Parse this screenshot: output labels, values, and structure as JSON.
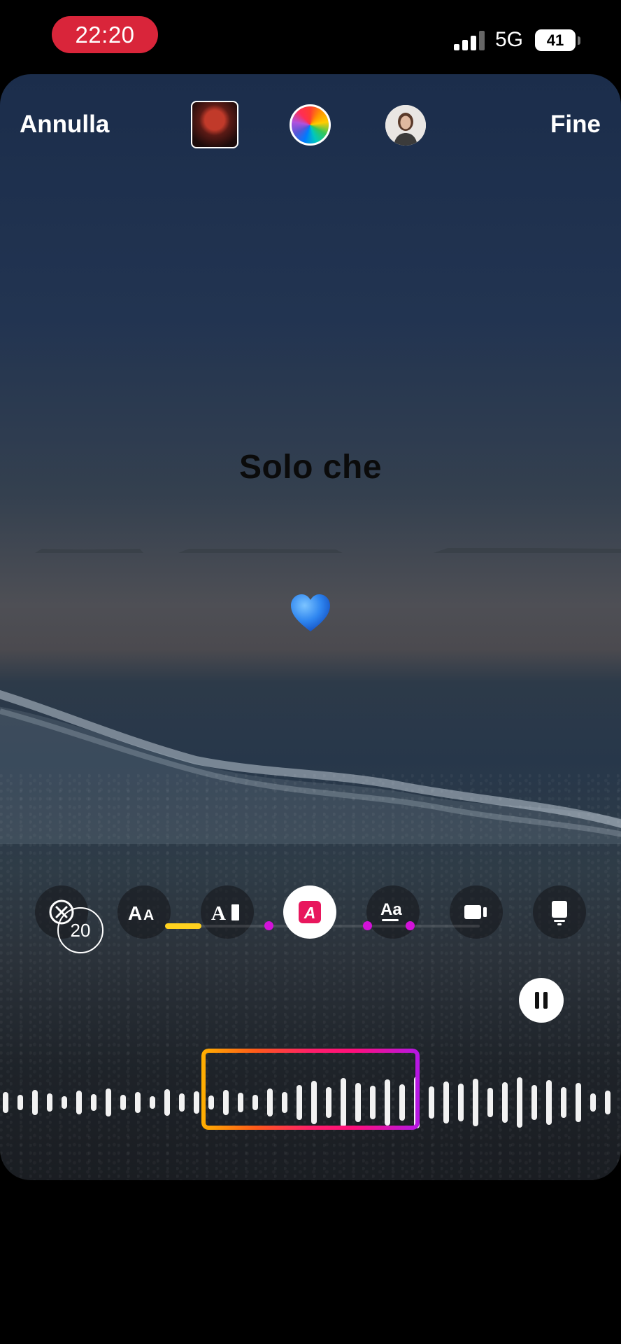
{
  "status_bar": {
    "time": "22:20",
    "network": "5G",
    "battery": "41",
    "time_pill_color": "#d9253a"
  },
  "editor": {
    "cancel_label": "Annulla",
    "done_label": "Fine",
    "lyric_text": "Solo che",
    "sticker_emoji": "💙"
  },
  "toolbar": {
    "items": [
      {
        "icon": "close-circle-icon",
        "active": false
      },
      {
        "icon": "font-size-icon",
        "active": false
      },
      {
        "icon": "typewriter-style-icon",
        "active": false
      },
      {
        "icon": "highlight-style-icon",
        "active": true
      },
      {
        "icon": "text-underline-icon",
        "active": false
      },
      {
        "icon": "video-card-icon",
        "active": false
      },
      {
        "icon": "poster-card-icon",
        "active": false
      }
    ]
  },
  "playback": {
    "duration_seconds": "20",
    "progress_color": "#ffd21f",
    "marker_color": "#d312d9"
  },
  "colors": {
    "accent_gradient": [
      "#ffb000",
      "#ff1f6a",
      "#b517e6"
    ]
  }
}
